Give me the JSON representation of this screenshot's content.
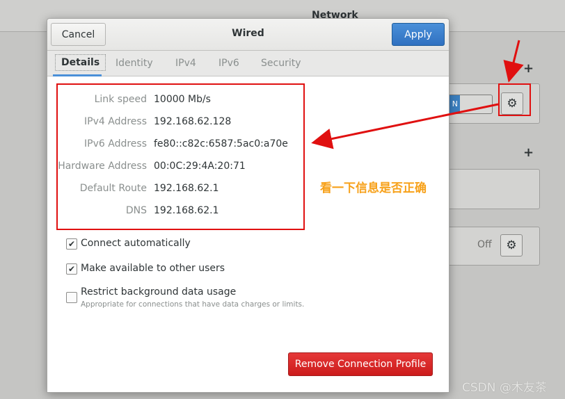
{
  "background": {
    "title": "Network",
    "plus_label": "+",
    "off_label": "Off",
    "switch_on_label": "N"
  },
  "dialog": {
    "title": "Wired",
    "cancel_label": "Cancel",
    "apply_label": "Apply",
    "tabs": [
      "Details",
      "Identity",
      "IPv4",
      "IPv6",
      "Security"
    ],
    "active_tab": "Details",
    "details": [
      {
        "label": "Link speed",
        "value": "10000 Mb/s"
      },
      {
        "label": "IPv4 Address",
        "value": "192.168.62.128"
      },
      {
        "label": "IPv6 Address",
        "value": "fe80::c82c:6587:5ac0:a70e"
      },
      {
        "label": "Hardware Address",
        "value": "00:0C:29:4A:20:71"
      },
      {
        "label": "Default Route",
        "value": "192.168.62.1"
      },
      {
        "label": "DNS",
        "value": "192.168.62.1"
      }
    ],
    "options": {
      "connect_auto": {
        "label": "Connect automatically",
        "checked": true
      },
      "available_users": {
        "label": "Make available to other users",
        "checked": true
      },
      "restrict_bg": {
        "label": "Restrict background data usage",
        "sublabel": "Appropriate for connections that have data charges or limits.",
        "checked": false
      }
    },
    "remove_label": "Remove Connection Profile"
  },
  "annotation": {
    "text": "看一下信息是否正确",
    "color": "#f7a11a",
    "arrow_color": "#e01010"
  },
  "watermark": "CSDN @木友茶",
  "icons": {
    "gear": "gear-icon",
    "check": "checkmark-icon"
  },
  "colors": {
    "accent": "#4a90d9",
    "destructive": "#cc1b1b",
    "annotation_red": "#e01010"
  }
}
